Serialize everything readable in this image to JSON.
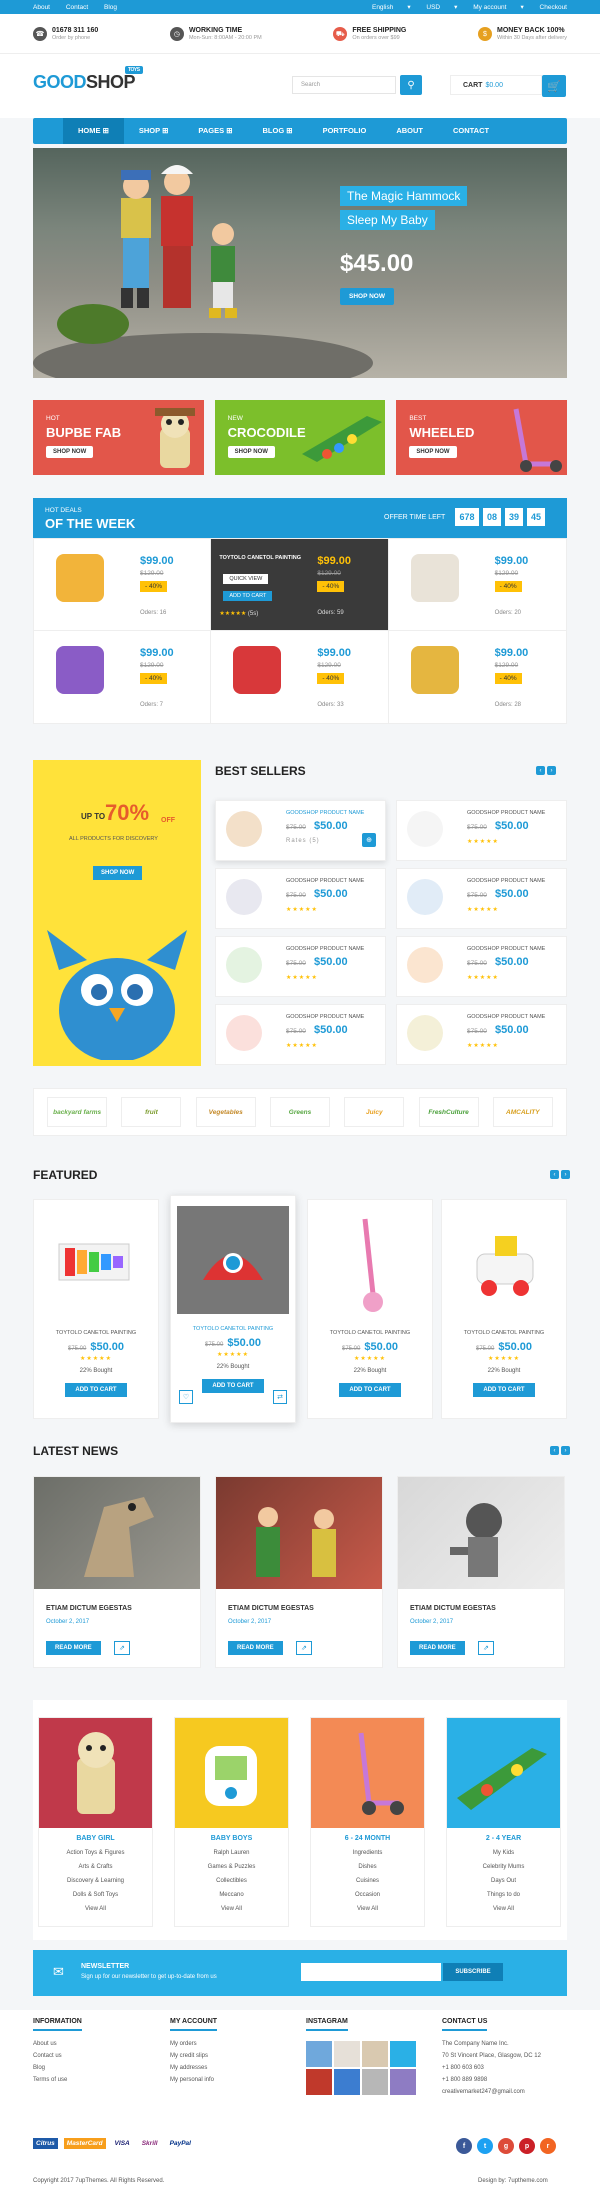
{
  "topbar": {
    "links": [
      "About",
      "Contact",
      "Blog"
    ],
    "right": [
      "English",
      "USD",
      "My account",
      "Checkout"
    ]
  },
  "info": [
    {
      "title": "01678 311 160",
      "sub": "Order by phone"
    },
    {
      "title": "WORKING TIME",
      "sub": "Mon-Sun: 8:00AM - 20:00 PM"
    },
    {
      "title": "FREE SHIPPING",
      "sub": "On orders over $99"
    },
    {
      "title": "MONEY BACK 100%",
      "sub": "Within 30 Days after delivery"
    }
  ],
  "header": {
    "logo_a": "GOOD",
    "logo_b": "SHOP",
    "logo_tag": "TOYS",
    "search_placeholder": "Search",
    "cart_label": "CART",
    "cart_value": "$0.00"
  },
  "nav": [
    "HOME",
    "SHOP",
    "PAGES",
    "BLOG",
    "PORTFOLIO",
    "ABOUT",
    "CONTACT"
  ],
  "hero": {
    "line1": "The Magic Hammock",
    "line2": "Sleep My Baby",
    "price": "$45.00",
    "button": "SHOP NOW"
  },
  "banners": [
    {
      "sub": "HOT",
      "title": "BUPBE FAB",
      "btn": "SHOP NOW"
    },
    {
      "sub": "NEW",
      "title": "CROCODILE",
      "btn": "SHOP NOW"
    },
    {
      "sub": "BEST",
      "title": "WHEELED",
      "btn": "SHOP NOW"
    }
  ],
  "deals_head": {
    "sub": "HOT DEALS",
    "title": "OF THE WEEK",
    "timer_label": "OFFER TIME LEFT",
    "timer": [
      "678",
      "08",
      "39",
      "45"
    ]
  },
  "deals": [
    {
      "price": "$99.00",
      "old": "$129.00",
      "disc": "- 40%",
      "orders": "Oders: 16"
    },
    {
      "title": "TOYTOLO CANETOL PAINTING",
      "price": "$99.00",
      "old": "$129.00",
      "disc": "- 40%",
      "orders": "Oders: 59",
      "quick": "QUICK VIEW",
      "add": "ADD TO CART",
      "stars": "★★★★★",
      "reviews": "(5s)"
    },
    {
      "price": "$99.00",
      "old": "$129.00",
      "disc": "- 40%",
      "orders": "Oders: 20"
    },
    {
      "price": "$99.00",
      "old": "$129.00",
      "disc": "- 40%",
      "orders": "Oders: 7"
    },
    {
      "price": "$99.00",
      "old": "$129.00",
      "disc": "- 40%",
      "orders": "Oders: 33"
    },
    {
      "price": "$99.00",
      "old": "$129.00",
      "disc": "- 40%",
      "orders": "Oders: 28"
    }
  ],
  "best_sellers": {
    "title": "BEST SELLERS",
    "promo": {
      "up": "UP TO",
      "pct": "70%",
      "off": "OFF",
      "all": "ALL PRODUCTS FOR DISCOVERY",
      "btn": "SHOP NOW"
    },
    "items": [
      {
        "name": "GOODSHOP PRODUCT NAME",
        "old": "$75.00",
        "price": "$50.00",
        "stars": "Rates (5)"
      },
      {
        "name": "GOODSHOP PRODUCT NAME",
        "old": "$75.00",
        "price": "$50.00",
        "stars": "★★★★★"
      },
      {
        "name": "GOODSHOP PRODUCT NAME",
        "old": "$75.00",
        "price": "$50.00",
        "stars": "★★★★★"
      },
      {
        "name": "GOODSHOP PRODUCT NAME",
        "old": "$75.00",
        "price": "$50.00",
        "stars": "★★★★★"
      },
      {
        "name": "GOODSHOP PRODUCT NAME",
        "old": "$75.00",
        "price": "$50.00",
        "stars": "★★★★★"
      },
      {
        "name": "GOODSHOP PRODUCT NAME",
        "old": "$75.00",
        "price": "$50.00",
        "stars": "★★★★★"
      },
      {
        "name": "GOODSHOP PRODUCT NAME",
        "old": "$75.00",
        "price": "$50.00",
        "stars": "★★★★★"
      },
      {
        "name": "GOODSHOP PRODUCT NAME",
        "old": "$75.00",
        "price": "$50.00",
        "stars": "★★★★★"
      }
    ]
  },
  "brands": [
    "backyard farms",
    "fruit",
    "Vegetables",
    "Greens",
    "Juicy",
    "FreshCulture",
    "AMCALITY"
  ],
  "featured": {
    "title": "FEATURED",
    "items": [
      {
        "name": "TOYTOLO CANETOL PAINTING",
        "old": "$75.00",
        "price": "$50.00",
        "stars": "★★★★★",
        "bought": "22% Bought",
        "btn": "ADD TO CART"
      },
      {
        "name": "TOYTOLO CANETOL PAINTING",
        "old": "$75.00",
        "price": "$50.00",
        "stars": "★★★★★",
        "bought": "22% Bought",
        "btn": "ADD TO CART"
      },
      {
        "name": "TOYTOLO CANETOL PAINTING",
        "old": "$75.00",
        "price": "$50.00",
        "stars": "★★★★★",
        "bought": "22% Bought",
        "btn": "ADD TO CART"
      },
      {
        "name": "TOYTOLO CANETOL PAINTING",
        "old": "$75.00",
        "price": "$50.00",
        "stars": "★★★★★",
        "bought": "22% Bought",
        "btn": "ADD TO CART"
      }
    ]
  },
  "news": {
    "title": "LATEST NEWS",
    "items": [
      {
        "title": "ETIAM DICTUM EGESTAS",
        "date": "October 2, 2017",
        "btn": "READ MORE"
      },
      {
        "title": "ETIAM DICTUM EGESTAS",
        "date": "October 2, 2017",
        "btn": "READ MORE"
      },
      {
        "title": "ETIAM DICTUM EGESTAS",
        "date": "October 2, 2017",
        "btn": "READ MORE"
      }
    ]
  },
  "categories": [
    {
      "title": "BABY GIRL",
      "items": [
        "Action Toys & Figures",
        "Arts & Crafts",
        "Discovery & Learning",
        "Dolls & Soft Toys",
        "View All"
      ]
    },
    {
      "title": "BABY BOYS",
      "items": [
        "Ralph Lauren",
        "Games & Puzzles",
        "Collectibles",
        "Meccano",
        "View All"
      ]
    },
    {
      "title": "6 - 24 MONTH",
      "items": [
        "Ingredients",
        "Dishes",
        "Cuisines",
        "Occasion",
        "View All"
      ]
    },
    {
      "title": "2 - 4 YEAR",
      "items": [
        "My Kids",
        "Celebrity Mums",
        "Days Out",
        "Things to do",
        "View All"
      ]
    }
  ],
  "newsletter": {
    "title": "NEWSLETTER",
    "sub": "Sign up for our newsletter to get up-to-date from us",
    "btn": "SUBSCRIBE"
  },
  "footer": {
    "information": {
      "title": "INFORMATION",
      "items": [
        "About us",
        "Contact us",
        "Blog",
        "Terms of use"
      ]
    },
    "account": {
      "title": "MY ACCOUNT",
      "items": [
        "My orders",
        "My credit slips",
        "My addresses",
        "My personal info"
      ]
    },
    "instagram": {
      "title": "INSTAGRAM"
    },
    "contact": {
      "title": "CONTACT US",
      "items": [
        "The Company Name Inc.",
        "70 St Vincent Place, Glasgow, DC 12",
        "+1 800 603 603",
        "+1 800 889 9898",
        "creativemarket247@gmail.com"
      ]
    },
    "pays": [
      "Citrus",
      "MasterCard",
      "VISA",
      "Skrill",
      "PayPal"
    ],
    "copyright": "Copyright 2017 7upThemes. All Rights Reserved.",
    "design": "Design by: 7uptheme.com"
  }
}
